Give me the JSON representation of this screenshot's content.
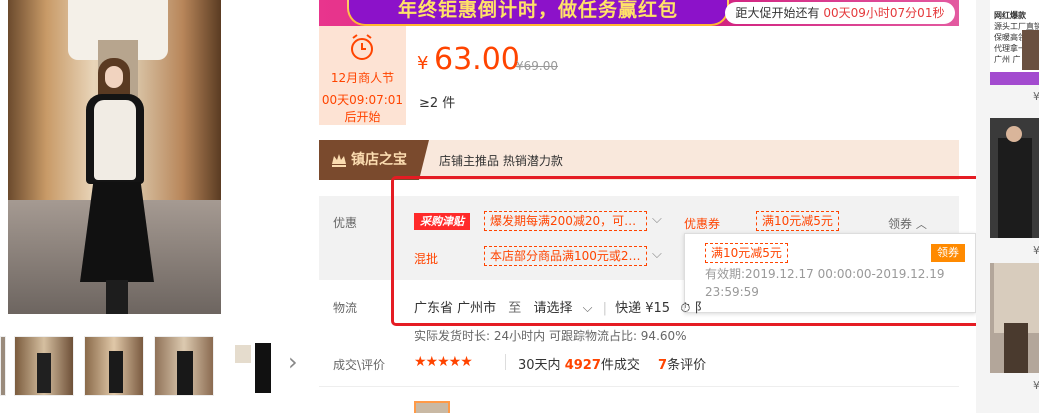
{
  "banner": {
    "slogan": "年终钜惠倒计时，做任务赢红包",
    "countdown_prefix": "距大促开始还有",
    "countdown_value": "00天09小时07分01秒"
  },
  "event": {
    "name": "12月商人节",
    "timer": "00天09:07:01",
    "status": "后开始"
  },
  "price": {
    "currency": "¥",
    "current": "63.00",
    "original": "¥69.00",
    "min_qty": "≥2 件"
  },
  "treasure": {
    "badge": "镇店之宝",
    "text": "店铺主推品  热销潜力款"
  },
  "promo": {
    "label": "优惠",
    "tag": "采购津贴",
    "offer1": "爆发期每满200减20，可…",
    "coupon_label": "优惠券",
    "coupon_value": "满10元减5元",
    "claim": "领券",
    "mixed_label": "混批",
    "mixed_value": "本店部分商品满100元或2…"
  },
  "popup": {
    "coupon": "满10元减5元",
    "claim_button": "领券",
    "validity_label": "有效期:",
    "validity_value": "2019.12.17 00:00:00-2019.12.19 23:59:59"
  },
  "shipping": {
    "label": "物流",
    "origin": "广东省 广州市",
    "to": "至",
    "dest": "请选择",
    "express": "快递 ¥15",
    "extra": "阝",
    "stats": "实际发货时长: 24小时内   可跟踪物流占比: 94.60%"
  },
  "deals": {
    "label": "成交\\评价",
    "stars": "★★★★★",
    "days": "30天内",
    "count": "4927",
    "unit": "件成交",
    "reviews": "7",
    "reviews_unit": "条评价"
  },
  "sidebar": {
    "card1_text1": "网红爆款",
    "card1_text2": "源头工厂直销",
    "card1_text3": "保暖高领内搭衫",
    "card1_text4": "代理拿一件包邮",
    "card1_text5": "广州 广 州 秀",
    "price_symbol": "¥"
  },
  "colors": {
    "accent": "#ff4400",
    "highlight_box": "#e51c23",
    "banner_pink": "#e8358d",
    "banner_purple": "#8c12c9"
  }
}
